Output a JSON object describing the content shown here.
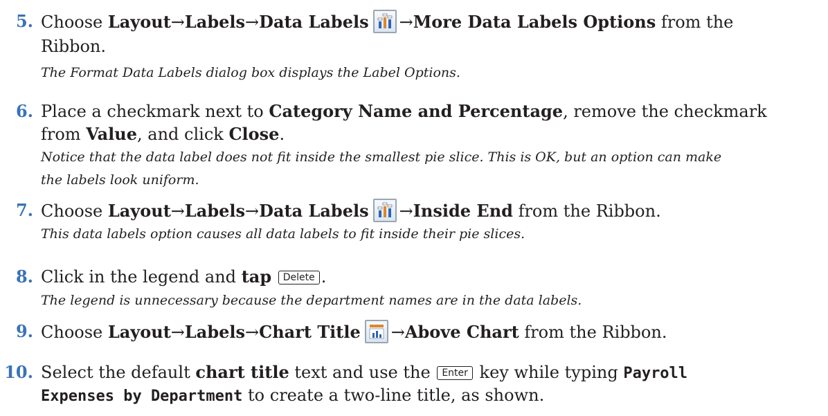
{
  "steps": [
    {
      "num": "5.",
      "lines": [
        {
          "t1": "Choose ",
          "b1": "Layout",
          "a1": "→",
          "b2": "Labels",
          "a2": "→",
          "b3": "Data Labels",
          "a3": "→",
          "b4": "More Data Labels Options",
          "t2": " from the"
        },
        {
          "t1": "Ribbon."
        }
      ],
      "icon": "data-labels-icon",
      "note": "The Format Data Labels dialog box displays the Label Options."
    },
    {
      "num": "6.",
      "lines": [
        {
          "t1": "Place a checkmark next to ",
          "b1": "Category Name and Percentage",
          "t2": ", remove the checkmark"
        },
        {
          "t1": "from ",
          "b1": "Value",
          "t2": ", and click ",
          "b2": "Close",
          "t3": "."
        }
      ],
      "note_lines": [
        "Notice that the data label does not fit inside the smallest pie slice. This is OK, but an option can make",
        "the labels look uniform."
      ]
    },
    {
      "num": "7.",
      "lines": [
        {
          "t1": "Choose ",
          "b1": "Layout",
          "a1": "→",
          "b2": "Labels",
          "a2": "→",
          "b3": "Data Labels",
          "a3": "→",
          "b4": "Inside End",
          "t2": " from the Ribbon."
        }
      ],
      "icon": "data-labels-icon",
      "note": "This data labels option causes all data labels to fit inside their pie slices."
    },
    {
      "num": "8.",
      "lines": [
        {
          "t1": "Click in the legend and ",
          "b1": "tap",
          "key": "Delete",
          "t2": "."
        }
      ],
      "note": "The legend is unnecessary because the department names are in the data labels."
    },
    {
      "num": "9.",
      "lines": [
        {
          "t1": "Choose ",
          "b1": "Layout",
          "a1": "→",
          "b2": "Labels",
          "a2": "→",
          "b3": "Chart Title",
          "a3": "→",
          "b4": "Above Chart",
          "t2": " from the Ribbon."
        }
      ],
      "icon": "chart-title-icon"
    },
    {
      "num": "10.",
      "lines": [
        {
          "t1": "Select the default ",
          "b1": "chart title",
          "t2": " text and use the ",
          "key": "Enter",
          "t3": " key while typing ",
          "m1": "Payroll"
        },
        {
          "m1": "Expenses by Department",
          "t1": " to create a two-line title, as shown."
        }
      ]
    }
  ]
}
